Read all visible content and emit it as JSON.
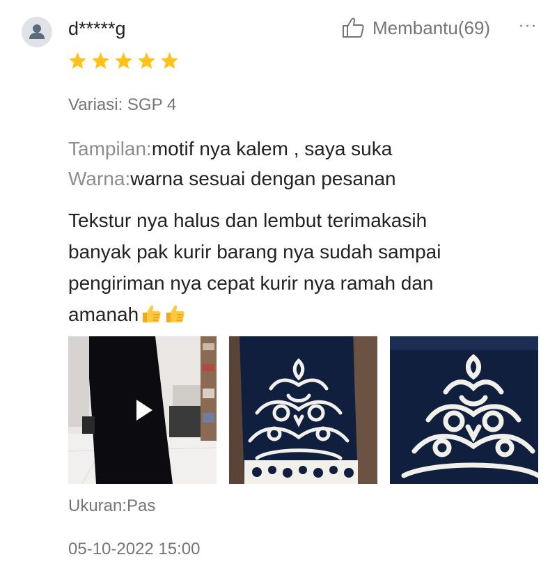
{
  "review": {
    "username": "d*****g",
    "rating": 5,
    "rating_max": 5,
    "helpful_label": "Membantu(69)",
    "more_label": "···",
    "variation": "Variasi: SGP 4",
    "attributes": [
      {
        "key": "Tampilan:",
        "value": "motif nya kalem , saya suka"
      },
      {
        "key": "Warna:",
        "value": "warna sesuai dengan pesanan"
      }
    ],
    "comment_lines": [
      "Tekstur nya halus dan lembut terimakasih",
      "banyak pak kurir barang nya sudah sampai",
      "pengiriman nya cepat kurir nya ramah dan",
      "amanah"
    ],
    "comment_emoji": [
      "thumbs-up-emoji",
      "thumbs-up-emoji"
    ],
    "media": [
      {
        "kind": "video",
        "icon": "play-icon"
      },
      {
        "kind": "image"
      },
      {
        "kind": "image"
      }
    ],
    "size_fit": "Ukuran:Pas",
    "timestamp": "05-10-2022 15:00"
  },
  "colors": {
    "star": "#ffc21a",
    "muted_text": "#757575",
    "attr_key": "#8e8e8e",
    "main_text": "#222222",
    "fabric_navy": "#0f1f3d"
  }
}
